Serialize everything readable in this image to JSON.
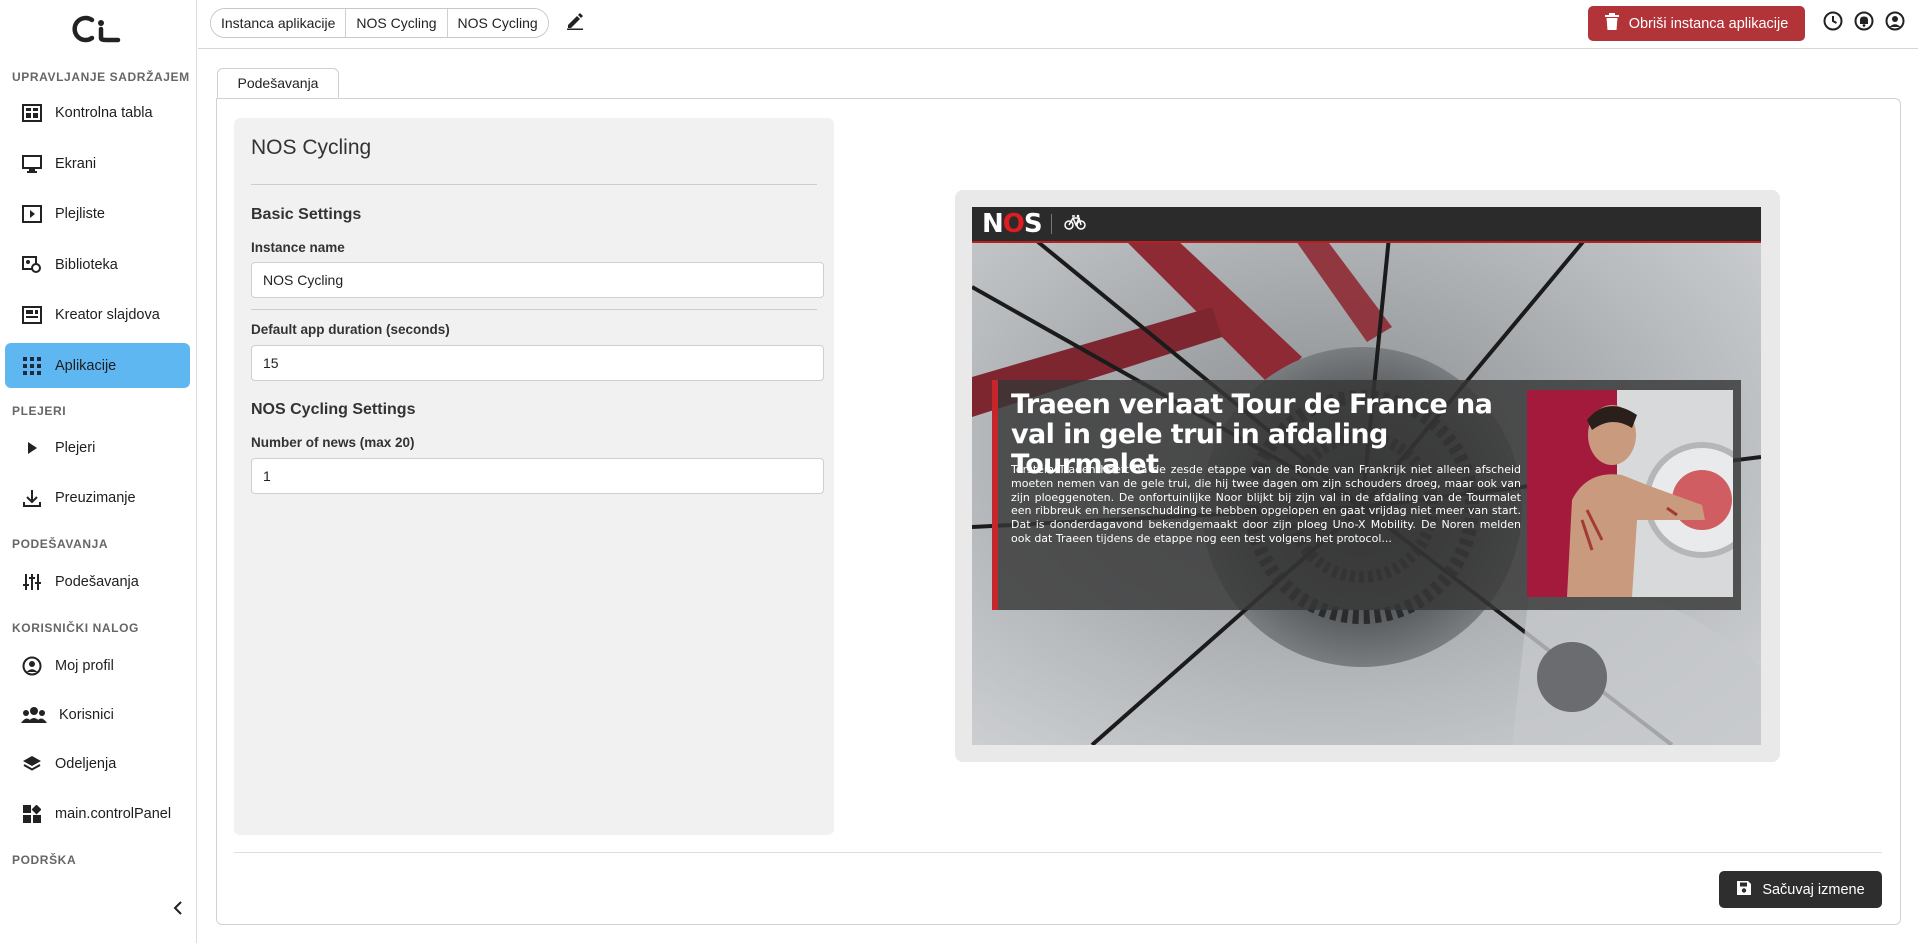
{
  "sidebar": {
    "sections": {
      "content": "UPRAVLJANJE SADRŽAJEM",
      "players": "PLEJERI",
      "settings": "PODEŠAVANJA",
      "account": "KORISNIČKI NALOG",
      "support": "PODRŠKA"
    },
    "items": {
      "dashboard": "Kontrolna tabla",
      "screens": "Ekrani",
      "playlists": "Plejliste",
      "library": "Biblioteka",
      "slide_creator": "Kreator slajdova",
      "apps": "Aplikacije",
      "players": "Plejeri",
      "downloads": "Preuzimanje",
      "settings": "Podešavanja",
      "profile": "Moj profil",
      "users": "Korisnici",
      "departments": "Odeljenja",
      "control_panel": "main.controlPanel"
    },
    "active_item": "Aplikacije",
    "accent_color": "#5fb7f1"
  },
  "header": {
    "breadcrumb": [
      "Instanca aplikacije",
      "NOS Cycling",
      "NOS Cycling"
    ],
    "delete_label": "Obriši instanca aplikacije",
    "delete_color": "#b23338",
    "icons": [
      "history-icon",
      "bell-icon",
      "user-circle-icon"
    ]
  },
  "tabs": {
    "settings": "Podešavanja"
  },
  "form": {
    "title": "NOS Cycling",
    "basic_settings": "Basic Settings",
    "instance_name_label": "Instance name",
    "instance_name_value": "NOS Cycling",
    "duration_label": "Default app duration (seconds)",
    "duration_value": "15",
    "nos_settings": "NOS Cycling Settings",
    "news_count_label": "Number of news (max 20)",
    "news_count_value": "1"
  },
  "preview": {
    "logo": "NOS",
    "headline": "Traeen verlaat Tour de France na val in gele trui in afdaling Tourmalet",
    "body": "Torstein Traeen heeft na de zesde etappe van de Ronde van Frankrijk niet alleen afscheid moeten nemen van de gele trui, die hij twee dagen om zijn schouders droeg, maar ook van zijn ploeggenoten. De onfortuinlijke Noor blijkt bij zijn val in de afdaling van de Tourmalet een ribbreuk en hersenschudding te hebben opgelopen en gaat vrijdag niet meer van start. Dat is donderdagavond bekendgemaakt door zijn ploeg Uno-X Mobility. De Noren melden ook dat Traeen tijdens de etappe nog een test volgens het protocol..."
  },
  "footer": {
    "save_label": "Sačuvaj izmene"
  }
}
